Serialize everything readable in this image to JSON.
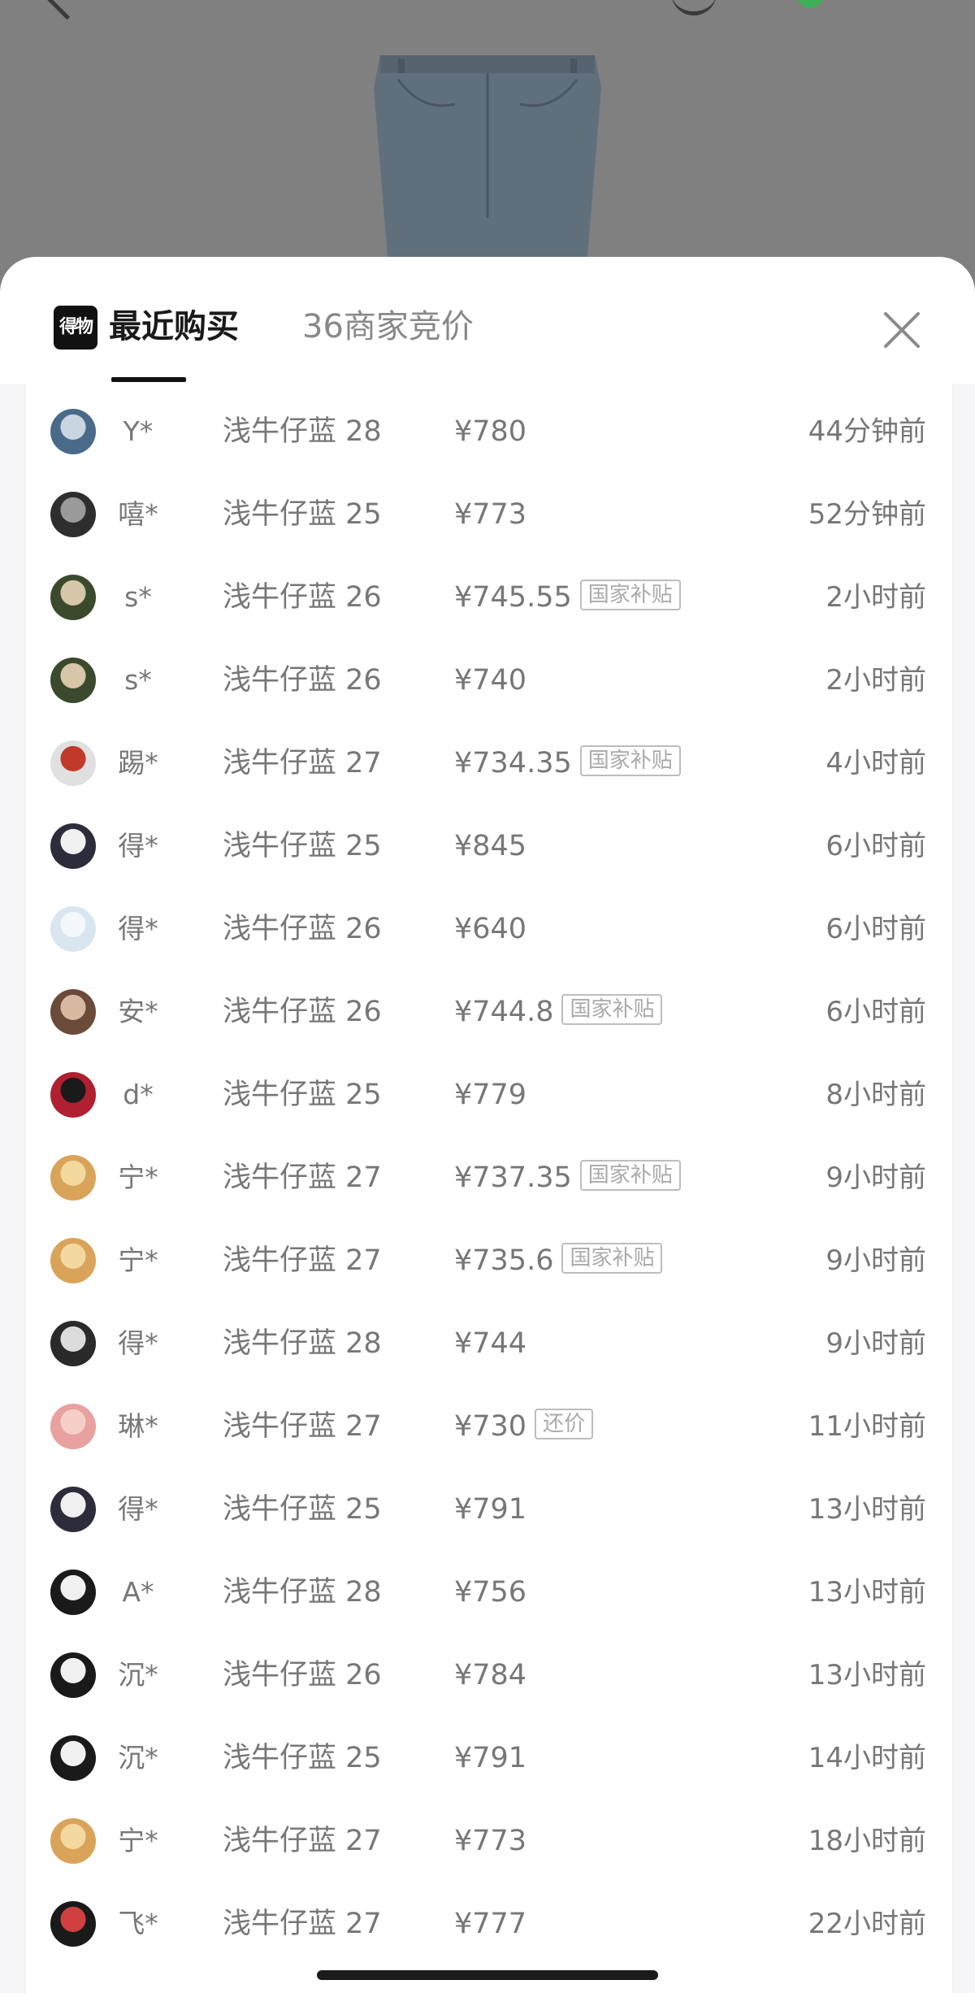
{
  "tabs": {
    "logo_text": "得物",
    "recent_label": "最近购买",
    "bids_label": "36商家竞价"
  },
  "colors": {
    "accent": "#111111",
    "text_muted": "#777777",
    "tag_border": "#bdbdbd"
  },
  "purchases": [
    {
      "user": "Y*",
      "spec": "浅牛仔蓝 28",
      "price": "¥780",
      "tag": "",
      "time": "44分钟前"
    },
    {
      "user": "嘻*",
      "spec": "浅牛仔蓝 25",
      "price": "¥773",
      "tag": "",
      "time": "52分钟前"
    },
    {
      "user": "s*",
      "spec": "浅牛仔蓝 26",
      "price": "¥745.55",
      "tag": "国家补贴",
      "time": "2小时前"
    },
    {
      "user": "s*",
      "spec": "浅牛仔蓝 26",
      "price": "¥740",
      "tag": "",
      "time": "2小时前"
    },
    {
      "user": "踢*",
      "spec": "浅牛仔蓝 27",
      "price": "¥734.35",
      "tag": "国家补贴",
      "time": "4小时前"
    },
    {
      "user": "得*",
      "spec": "浅牛仔蓝 25",
      "price": "¥845",
      "tag": "",
      "time": "6小时前"
    },
    {
      "user": "得*",
      "spec": "浅牛仔蓝 26",
      "price": "¥640",
      "tag": "",
      "time": "6小时前"
    },
    {
      "user": "安*",
      "spec": "浅牛仔蓝 26",
      "price": "¥744.8",
      "tag": "国家补贴",
      "time": "6小时前"
    },
    {
      "user": "d*",
      "spec": "浅牛仔蓝 25",
      "price": "¥779",
      "tag": "",
      "time": "8小时前"
    },
    {
      "user": "宁*",
      "spec": "浅牛仔蓝 27",
      "price": "¥737.35",
      "tag": "国家补贴",
      "time": "9小时前"
    },
    {
      "user": "宁*",
      "spec": "浅牛仔蓝 27",
      "price": "¥735.6",
      "tag": "国家补贴",
      "time": "9小时前"
    },
    {
      "user": "得*",
      "spec": "浅牛仔蓝 28",
      "price": "¥744",
      "tag": "",
      "time": "9小时前"
    },
    {
      "user": "琳*",
      "spec": "浅牛仔蓝 27",
      "price": "¥730",
      "tag": "还价",
      "time": "11小时前"
    },
    {
      "user": "得*",
      "spec": "浅牛仔蓝 25",
      "price": "¥791",
      "tag": "",
      "time": "13小时前"
    },
    {
      "user": "A*",
      "spec": "浅牛仔蓝 28",
      "price": "¥756",
      "tag": "",
      "time": "13小时前"
    },
    {
      "user": "沉*",
      "spec": "浅牛仔蓝 26",
      "price": "¥784",
      "tag": "",
      "time": "13小时前"
    },
    {
      "user": "沉*",
      "spec": "浅牛仔蓝 25",
      "price": "¥791",
      "tag": "",
      "time": "14小时前"
    },
    {
      "user": "宁*",
      "spec": "浅牛仔蓝 27",
      "price": "¥773",
      "tag": "",
      "time": "18小时前"
    },
    {
      "user": "飞*",
      "spec": "浅牛仔蓝 27",
      "price": "¥777",
      "tag": "",
      "time": "22小时前"
    }
  ]
}
